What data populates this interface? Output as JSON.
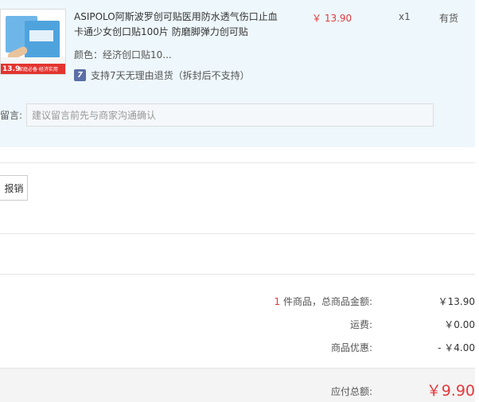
{
  "product": {
    "title": "ASIPOLO阿斯波罗创可贴医用防水透气伤口止血卡通少女创口贴100片 防磨脚弹力创可贴",
    "color_line": "颜色：经济创口贴10...",
    "return_badge": "7",
    "return_policy": "支持7天无理由退货（拆封后不支持）",
    "unit_price": "￥ 13.90",
    "quantity": "x1",
    "stock_status": "有货",
    "image": {
      "price_tag": "13.9",
      "tag_text": "家庭必备·经济实用"
    }
  },
  "memo": {
    "label": "留言:",
    "placeholder": "建议留言前先与商家沟通确认"
  },
  "invoice": {
    "button_label": "报销"
  },
  "summary": {
    "item_count": "1",
    "count_suffix": " 件商品，总商品金额:",
    "items_total": "￥13.90",
    "shipping_label": "运费:",
    "shipping_value": "￥0.00",
    "discount_label": "商品优惠:",
    "discount_value": "- ￥4.00",
    "payable_label": "应付总额:",
    "payable_value": "￥9.90"
  },
  "colors": {
    "accent_red": "#e4393c",
    "panel_bg": "#eef7fb",
    "badge_blue": "#5b6ea6"
  }
}
